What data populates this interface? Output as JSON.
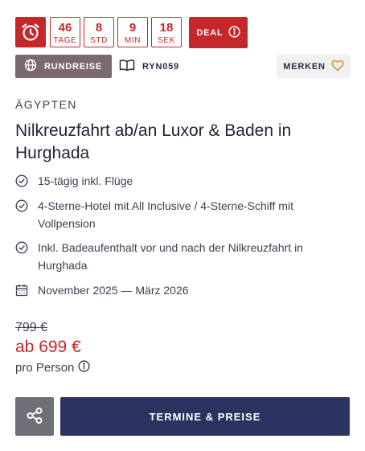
{
  "countdown": [
    {
      "value": "46",
      "unit": "TAGE"
    },
    {
      "value": "8",
      "unit": "STD"
    },
    {
      "value": "9",
      "unit": "MIN"
    },
    {
      "value": "18",
      "unit": "SEK"
    }
  ],
  "deal_label": "DEAL",
  "tag_label": "RUNDREISE",
  "trip_code": "RYN059",
  "save_label": "MERKEN",
  "country": "ÄGYPTEN",
  "title": "Nilkreuzfahrt ab/an Luxor & Baden in Hurghada",
  "features": [
    {
      "icon": "check-circle-icon",
      "text": "15-tägig inkl. Flüge"
    },
    {
      "icon": "check-circle-icon",
      "text": "4-Sterne-Hotel mit All Inclusive / 4-Sterne-Schiff mit Vollpension"
    },
    {
      "icon": "check-circle-icon",
      "text": "Inkl. Badeaufenthalt vor und nach der Nilkreuzfahrt in Hurghada"
    },
    {
      "icon": "calendar-icon",
      "text": "November 2025 — März 2026"
    }
  ],
  "price": {
    "old": "799 €",
    "current": "ab 699 €",
    "per": "pro Person"
  },
  "cta_label": "TERMINE & PREISE",
  "colors": {
    "accent_red": "#c4282a",
    "navy": "#2b3360",
    "tag_bg": "#7b6970",
    "share_bg": "#6f6f77"
  }
}
